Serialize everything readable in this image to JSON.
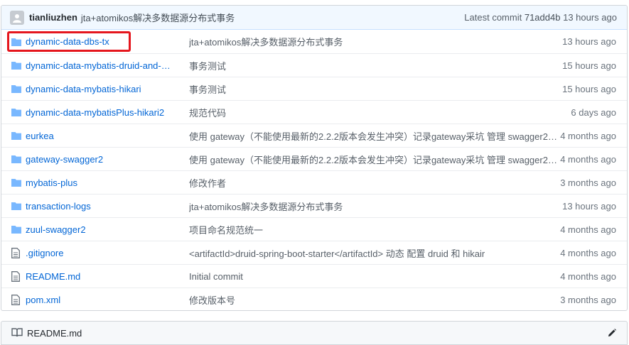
{
  "latest_commit": {
    "author": "tianliuzhen",
    "message": "jta+atomikos解决多数据源分布式事务",
    "label": "Latest commit",
    "sha": "71add4b",
    "age": "13 hours ago"
  },
  "files": [
    {
      "type": "folder",
      "name": "dynamic-data-dbs-tx",
      "message": "jta+atomikos解决多数据源分布式事务",
      "age": "13 hours ago"
    },
    {
      "type": "folder",
      "name": "dynamic-data-mybatis-druid-and-…",
      "message": "事务测试",
      "age": "15 hours ago"
    },
    {
      "type": "folder",
      "name": "dynamic-data-mybatis-hikari",
      "message": "事务测试",
      "age": "15 hours ago"
    },
    {
      "type": "folder",
      "name": "dynamic-data-mybatisPlus-hikari2",
      "message": "规范代码",
      "age": "6 days ago"
    },
    {
      "type": "folder",
      "name": "eurkea",
      "message": "使用 gateway（不能使用最新的2.2.2版本会发生冲突）记录gateway采坑 管理 swagger2，…",
      "age": "4 months ago"
    },
    {
      "type": "folder",
      "name": "gateway-swagger2",
      "message": "使用 gateway（不能使用最新的2.2.2版本会发生冲突）记录gateway采坑 管理 swagger2，…",
      "age": "4 months ago"
    },
    {
      "type": "folder",
      "name": "mybatis-plus",
      "message": "修改作者",
      "age": "3 months ago"
    },
    {
      "type": "folder",
      "name": "transaction-logs",
      "message": "jta+atomikos解决多数据源分布式事务",
      "age": "13 hours ago"
    },
    {
      "type": "folder",
      "name": "zuul-swagger2",
      "message": "项目命名规范统一",
      "age": "4 months ago"
    },
    {
      "type": "file",
      "name": ".gitignore",
      "message": "<artifactId>druid-spring-boot-starter</artifactId> 动态 配置 druid 和 hikair",
      "age": "4 months ago"
    },
    {
      "type": "file",
      "name": "README.md",
      "message": "Initial commit",
      "age": "4 months ago"
    },
    {
      "type": "file",
      "name": "pom.xml",
      "message": "修改版本号",
      "age": "3 months ago"
    }
  ],
  "readme": {
    "title": "README.md",
    "icon": "book-icon",
    "edit_icon": "pencil-icon"
  },
  "colors": {
    "link": "#0366d6",
    "folder_icon": "#79b8ff",
    "highlight": "#e5161d",
    "commit_bar_bg": "#f1f8ff"
  }
}
